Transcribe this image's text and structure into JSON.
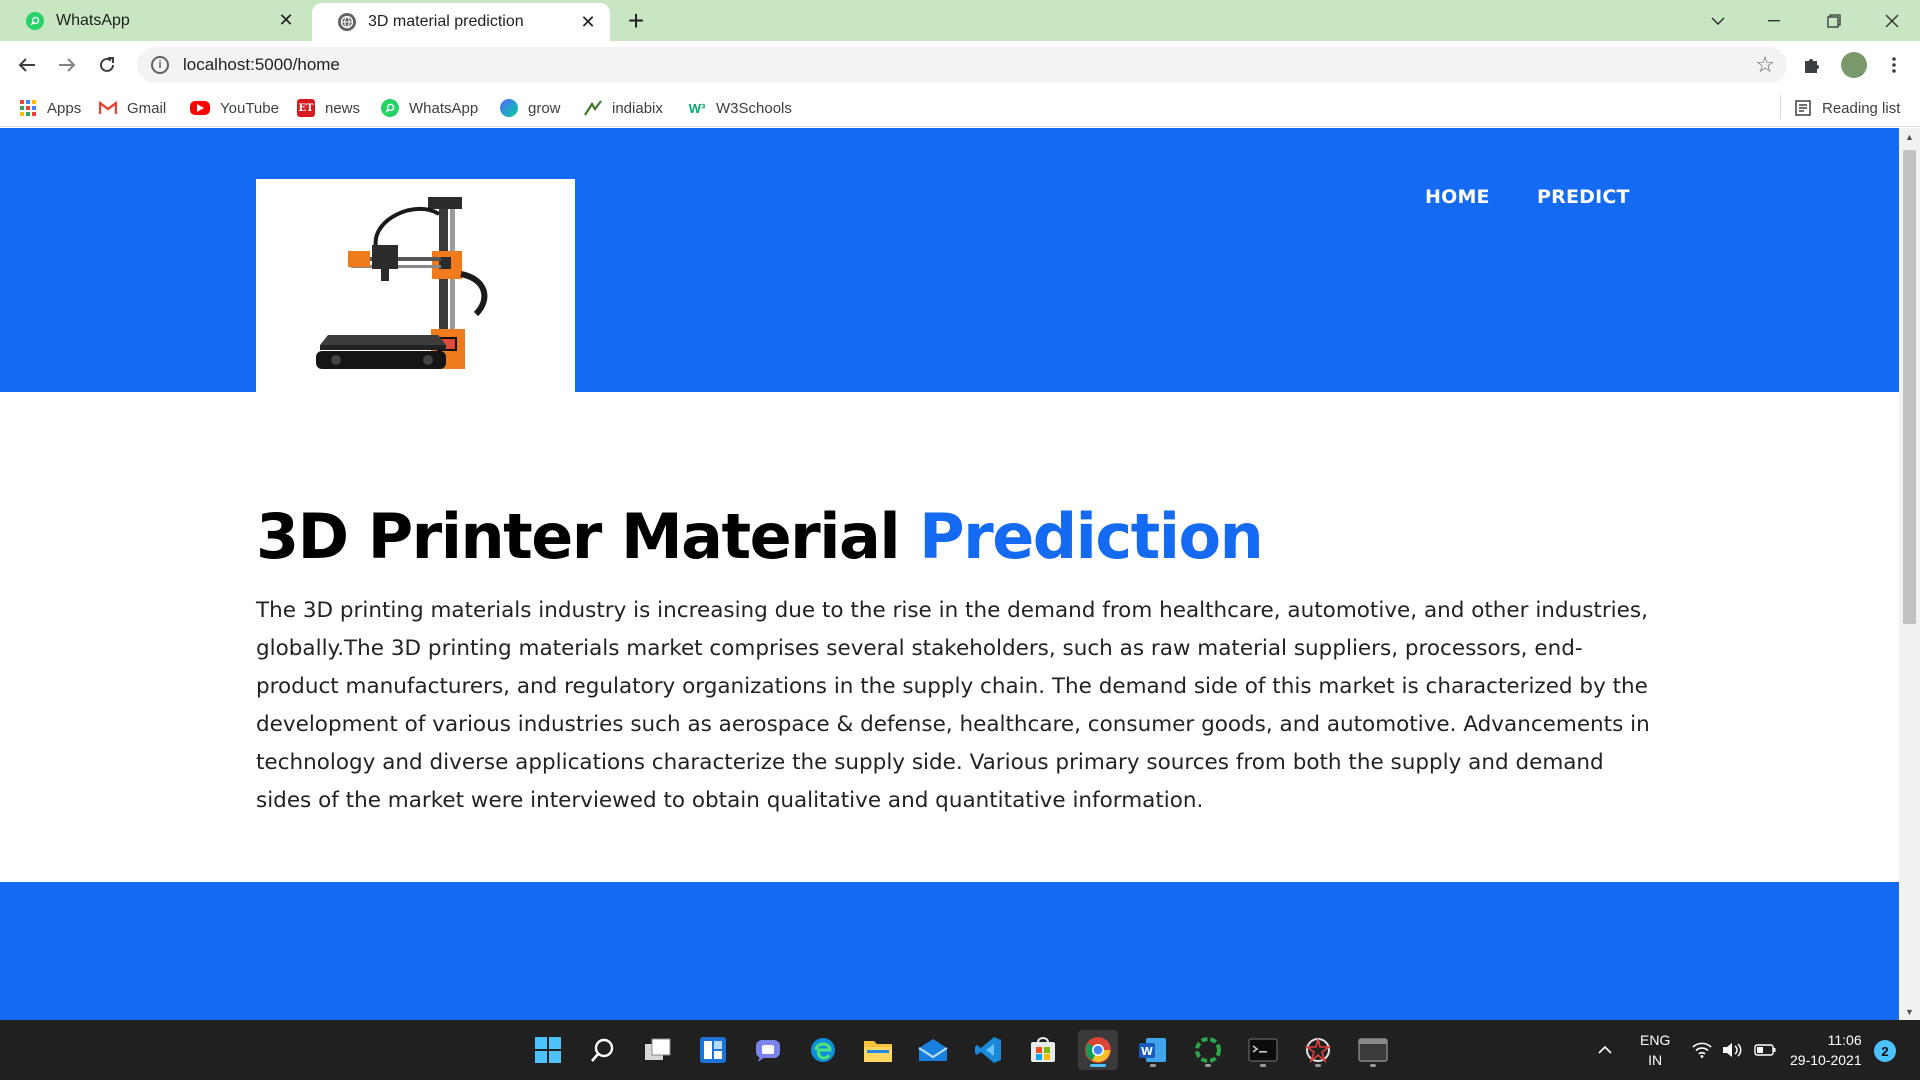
{
  "browser": {
    "tabs": [
      {
        "title": "WhatsApp",
        "active": false
      },
      {
        "title": "3D material prediction",
        "active": true
      }
    ],
    "new_tab_label": "+",
    "url": "localhost:5000/home"
  },
  "bookmarks": [
    {
      "label": "Apps",
      "icon": "apps-grid-icon"
    },
    {
      "label": "Gmail",
      "icon": "gmail-icon"
    },
    {
      "label": "YouTube",
      "icon": "youtube-icon"
    },
    {
      "label": "news",
      "icon": "et-news-icon"
    },
    {
      "label": "WhatsApp",
      "icon": "whatsapp-icon"
    },
    {
      "label": "grow",
      "icon": "grow-icon"
    },
    {
      "label": "indiabix",
      "icon": "indiabix-icon"
    },
    {
      "label": "W3Schools",
      "icon": "w3schools-icon"
    }
  ],
  "reading_list_label": "Reading list",
  "page": {
    "nav": {
      "home": "HOME",
      "predict": "PREDICT"
    },
    "logo_image": "3d-printer-image",
    "headline_main": "3D Printer Material ",
    "headline_accent": "Prediction",
    "description": "The 3D printing materials industry is increasing due to the rise in the demand from healthcare, automotive, and other industries, globally.The 3D printing materials market comprises several stakeholders, such as raw material suppliers, processors, end-product manufacturers, and regulatory organizations in the supply chain. The demand side of this market is characterized by the development of various industries such as aerospace & defense, healthcare, consumer goods, and automotive. Advancements in technology and diverse applications characterize the supply side. Various primary sources from both the supply and demand sides of the market were interviewed to obtain qualitative and quantitative information."
  },
  "colors": {
    "brand_blue": "#146af2",
    "tab_strip": "#c9e6c3",
    "taskbar": "#202020"
  },
  "taskbar": {
    "apps": [
      "start-icon",
      "search-icon",
      "task-view-icon",
      "widgets-icon",
      "teams-chat-icon",
      "edge-icon",
      "file-explorer-icon",
      "mail-icon",
      "vscode-icon",
      "store-icon",
      "chrome-icon",
      "word-icon",
      "spinner-app-icon",
      "terminal-icon",
      "settings-app-icon",
      "window-app-icon"
    ],
    "language_top": "ENG",
    "language_bottom": "IN",
    "time": "11:06",
    "date": "29-10-2021",
    "notification_count": "2"
  }
}
